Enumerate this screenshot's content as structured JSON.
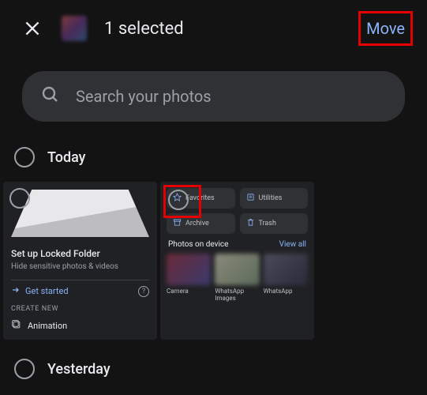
{
  "header": {
    "selected_text": "1 selected",
    "move_label": "Move"
  },
  "search": {
    "placeholder": "Search your photos"
  },
  "sections": {
    "today_label": "Today",
    "yesterday_label": "Yesterday"
  },
  "locked_folder": {
    "title": "Set up Locked Folder",
    "subtitle": "Hide sensitive photos & videos",
    "cta": "Get started",
    "create_header": "CREATE NEW",
    "animation": "Animation"
  },
  "library": {
    "chips": {
      "favorites": "Favorites",
      "utilities": "Utilities",
      "archive": "Archive",
      "trash": "Trash"
    },
    "photos_on_device": "Photos on device",
    "view_all": "View all",
    "folders": {
      "camera": "Camera",
      "whatsapp_images": "WhatsApp Images",
      "whatsapp": "WhatsApp"
    }
  }
}
